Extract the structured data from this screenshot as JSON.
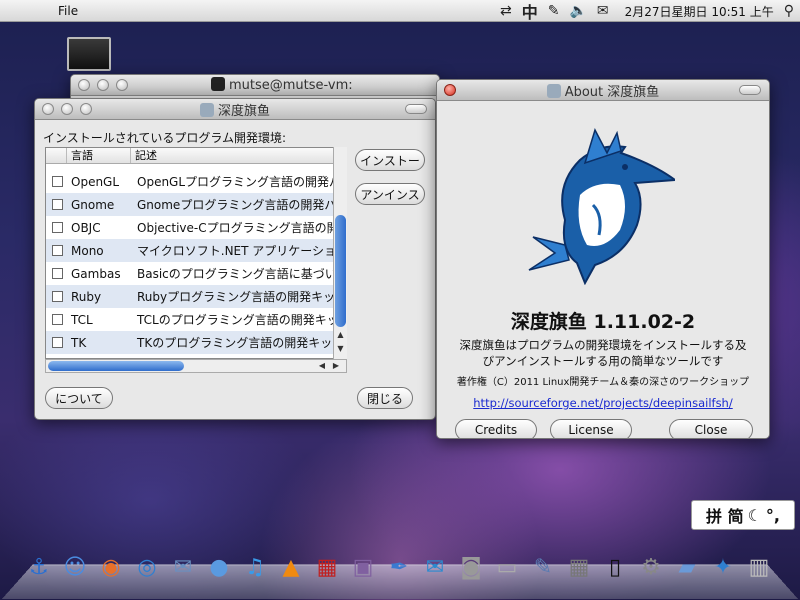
{
  "menubar": {
    "apple_glyph": "",
    "file_label": "File",
    "clock": "2月27日星期日 10:51 上午",
    "ime_glyph": "中",
    "spotlight_glyph": "🔍"
  },
  "terminal_window": {
    "title": "mutse@mutse-vm:"
  },
  "main_window": {
    "title": "深度旗鱼",
    "list_label": "インストールされているプログラム開発環境:",
    "columns": [
      "言語",
      "記述"
    ],
    "rows": [
      {
        "name": "OpenGL",
        "desc": "OpenGLプログラミング言語の開発パ"
      },
      {
        "name": "Gnome",
        "desc": "Gnomeプログラミング言語の開発パ"
      },
      {
        "name": "OBJC",
        "desc": "Objective-Cプログラミング言語の開"
      },
      {
        "name": "Mono",
        "desc": "マイクロソフト.NET アプリケーショ"
      },
      {
        "name": "Gambas",
        "desc": "Basicのプログラミング言語に基づい"
      },
      {
        "name": "Ruby",
        "desc": "Rubyプログラミング言語の開発キッ"
      },
      {
        "name": "TCL",
        "desc": "TCLのプログラミング言語の開発キッ"
      },
      {
        "name": "TK",
        "desc": "TKのプログラミング言語の開発キッ"
      }
    ],
    "install_button": "インストー",
    "uninstall_button": "アンインス",
    "about_button": "について",
    "close_button": "閉じる"
  },
  "about_window": {
    "title": "About 深度旗鱼",
    "app_name": "深度旗鱼 1.11.02-2",
    "description": "深度旗鱼はプログラムの開発環境をインストールする及びアンインストールする用の簡単なツールです",
    "copyright": "著作権（C）2011 Linux開発チーム＆秦の深さのワークショップ",
    "link": "http://sourceforge.net/projects/deepinsailfsh/",
    "credits_button": "Credits",
    "license_button": "License",
    "close_button": "Close"
  },
  "ime_indicator": {
    "text": "拼 简"
  },
  "dock": {
    "items": [
      "anchor-icon",
      "finder-icon",
      "firefox-icon",
      "chrome-icon",
      "mail-icon",
      "people-icon",
      "itunes-icon",
      "vlc-icon",
      "photo-booth-icon",
      "iphoto-icon",
      "quill-icon",
      "mail-app-icon",
      "camera-icon",
      "scanner-icon",
      "textedit-icon",
      "calculator-icon",
      "terminal-icon",
      "settings-icon",
      "folder-icon",
      "sailfish-icon",
      "trash-icon"
    ]
  },
  "colors": {
    "accent_blue": "#2f6dcc",
    "link_blue": "#1a2ad0",
    "close_red": "#d42d1c"
  }
}
